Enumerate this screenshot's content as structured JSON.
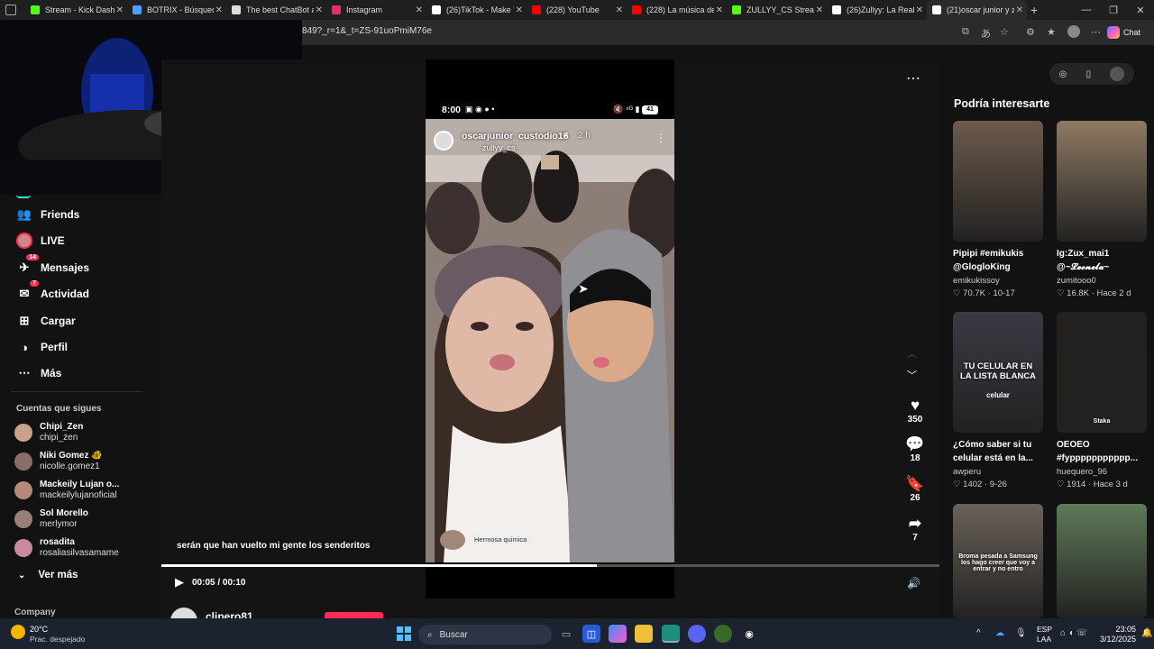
{
  "browser": {
    "tabs": [
      {
        "label": "Stream - Kick Dashb",
        "icon": "kick-icon",
        "color": "#53fc18"
      },
      {
        "label": "BOTRIX - Búsqueda",
        "icon": "search-icon",
        "color": "#4aa3ff"
      },
      {
        "label": "The best ChatBot ar",
        "icon": "botrix-icon",
        "color": "#dddddd"
      },
      {
        "label": "Instagram",
        "icon": "instagram-icon",
        "color": "#e1306c"
      },
      {
        "label": "(26)TikTok - Make Y",
        "icon": "tiktok-icon",
        "color": "#ffffff"
      },
      {
        "label": "(228) YouTube",
        "icon": "youtube-icon",
        "color": "#ff0000"
      },
      {
        "label": "(228) La música de",
        "icon": "youtube-icon",
        "color": "#ff0000"
      },
      {
        "label": "ZULLYY_CS Stream",
        "icon": "kick-icon",
        "color": "#53fc18"
      },
      {
        "label": "(26)Zullyy: La Real D",
        "icon": "tiktok-icon",
        "color": "#ffffff"
      },
      {
        "label": "(21)oscar junior y zu",
        "icon": "tiktok-icon",
        "color": "#ffffff"
      }
    ],
    "url": "849?_r=1&_t=ZS-91uoPmiM76e",
    "chat_label": "Chat"
  },
  "sidebar": {
    "nav": [
      {
        "label": "Friends",
        "icon": "friends-icon"
      },
      {
        "label": "LIVE",
        "icon": "live-avatar-icon"
      },
      {
        "label": "Mensajes",
        "icon": "messages-icon",
        "badge": "14"
      },
      {
        "label": "Actividad",
        "icon": "activity-icon",
        "badge": "7"
      },
      {
        "label": "Cargar",
        "icon": "upload-icon"
      },
      {
        "label": "Perfil",
        "icon": "profile-icon"
      },
      {
        "label": "Más",
        "icon": "more-icon"
      }
    ],
    "following_title": "Cuentas que sigues",
    "following": [
      {
        "name": "Chipi_Zen",
        "handle": "chipi_zen",
        "color": "#c9a28a"
      },
      {
        "name": "Niki Gomez 🐠",
        "handle": "nicolle.gomez1",
        "color": "#8a6f66"
      },
      {
        "name": "Mackeily Lujan o...",
        "handle": "mackeilylujanoficial",
        "color": "#b48a7a"
      },
      {
        "name": "Sol Morello",
        "handle": "merlymor",
        "color": "#9a7f76"
      },
      {
        "name": "rosadita",
        "handle": "rosaliasilvasamame",
        "color": "#c98aa0"
      }
    ],
    "see_more": "Ver más",
    "company": "Company"
  },
  "video": {
    "phone_time": "8:00",
    "phone_battery": "41",
    "author": "oscarjunior_custodio16",
    "time_ago": "2 h",
    "mention": "zullyy_cs",
    "sticker_text": "Hermosa quimica",
    "caption": "serán que han vuelto mi gente los senderitos",
    "current_time": "00:05",
    "separator": "/",
    "duration": "00:10",
    "progress": 0.56,
    "likes": "350",
    "comments": "18",
    "saves": "26",
    "shares": "7",
    "comment_user": "clipero81"
  },
  "recommendations": {
    "title": "Podría interesarte",
    "cards": [
      {
        "title": "Pipipi #emikukis",
        "title2": "@GlogloKing",
        "author": "emikukissoy",
        "likes": "70.7K",
        "date": "10-17",
        "color": "#6d5a4c"
      },
      {
        "title": "Ig:Zux_mai1",
        "title2": "@~𝓛𝓮𝓸𝓷𝓮𝓵𝓪~",
        "author": "zumitooo0",
        "likes": "16.8K",
        "date": "Hace 2 d",
        "color": "#8f7a62"
      },
      {
        "title": "¿Cómo saber si tu",
        "title2": "celular está en la...",
        "author": "awperu",
        "likes": "1402",
        "date": "9-26",
        "color": "#3b3a44",
        "overlay": "TU CELULAR EN LA LISTA BLANCA",
        "overlay2": "celular"
      },
      {
        "title": "OEOEO",
        "title2": "#fyppppppppppp...",
        "author": "huequero_96",
        "likes": "1914",
        "date": "Hace 3 d",
        "color": "#22211f",
        "overlay": "Staka"
      },
      {
        "title": "",
        "title2": "",
        "author": "",
        "likes": "",
        "date": "",
        "color": "#6a6258",
        "overlay": "Broma pesada a Samsung los hago creer que voy a entrar y no entro"
      },
      {
        "title": "",
        "title2": "",
        "author": "",
        "likes": "",
        "date": "",
        "color": "#5f7a58"
      }
    ]
  },
  "taskbar": {
    "weather_temp": "20°C",
    "weather_desc": "Prac. despejado",
    "search_label": "Buscar",
    "lang": "ESP",
    "lang2": "LAA",
    "time": "23:05",
    "date": "3/12/2025"
  }
}
